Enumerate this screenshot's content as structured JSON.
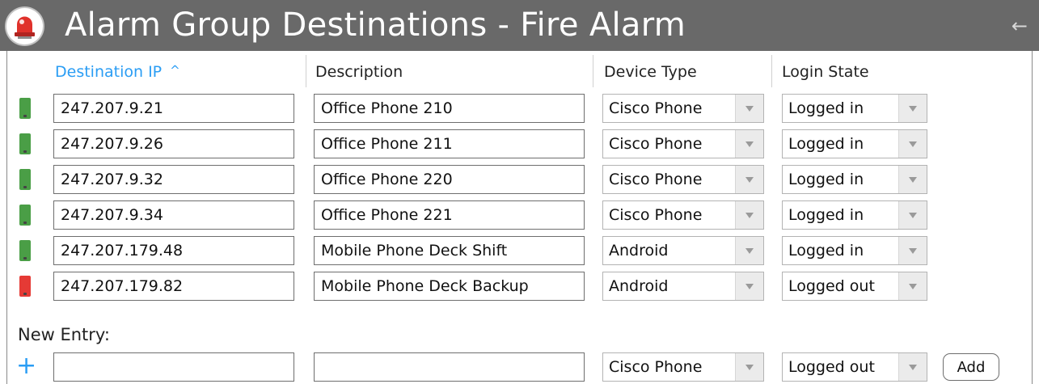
{
  "window": {
    "title": "Alarm Group Destinations - Fire Alarm",
    "back_icon": "arrow-left-icon",
    "title_icon": "alarm-bell-icon"
  },
  "colors": {
    "titlebar": "#696969",
    "accent": "#2a9df4",
    "status_ok": "#4a9e46",
    "status_bad": "#e53a35"
  },
  "table": {
    "headers": {
      "ip": "Destination IP",
      "ip_sort_indicator": "^",
      "description": "Description",
      "device_type": "Device Type",
      "login_state": "Login State"
    },
    "rows": [
      {
        "status": "logged-in",
        "ip": "247.207.9.21",
        "description": "Office Phone 210",
        "device_type": "Cisco Phone",
        "login_state": "Logged in"
      },
      {
        "status": "logged-in",
        "ip": "247.207.9.26",
        "description": "Office Phone 211",
        "device_type": "Cisco Phone",
        "login_state": "Logged in"
      },
      {
        "status": "logged-in",
        "ip": "247.207.9.32",
        "description": "Office Phone 220",
        "device_type": "Cisco Phone",
        "login_state": "Logged in"
      },
      {
        "status": "logged-in",
        "ip": "247.207.9.34",
        "description": "Office Phone 221",
        "device_type": "Cisco Phone",
        "login_state": "Logged in"
      },
      {
        "status": "logged-in",
        "ip": "247.207.179.48",
        "description": "Mobile Phone Deck Shift",
        "device_type": "Android",
        "login_state": "Logged in"
      },
      {
        "status": "logged-out",
        "ip": "247.207.179.82",
        "description": "Mobile Phone Deck Backup",
        "device_type": "Android",
        "login_state": "Logged out"
      }
    ]
  },
  "new_entry": {
    "label": "New Entry:",
    "ip_value": "",
    "description_value": "",
    "device_type": "Cisco Phone",
    "login_state": "Logged out",
    "add_label": "Add",
    "add_icon": "plus-icon"
  }
}
